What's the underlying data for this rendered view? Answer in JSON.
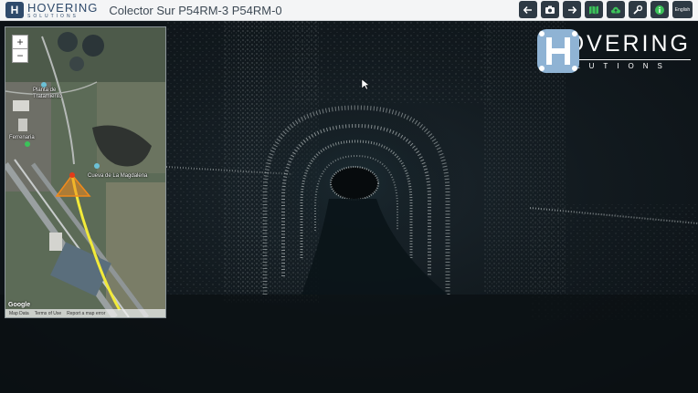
{
  "app": {
    "brand_name": "HOVERING",
    "brand_sub": "SOLUTIONS",
    "title": "Colector Sur P54RM-3 P54RM-0"
  },
  "toolbar": {
    "buttons": [
      {
        "icon": "arrow-left-icon"
      },
      {
        "icon": "camera-icon"
      },
      {
        "icon": "arrow-right-icon"
      },
      {
        "icon": "map-icon"
      },
      {
        "icon": "cloud-upload-icon"
      },
      {
        "icon": "wrench-icon"
      },
      {
        "icon": "info-icon"
      }
    ],
    "language": "English"
  },
  "watermark": {
    "name": "HOVERING",
    "sub": "SOLUTIONS"
  },
  "minimap": {
    "zoom_in": "+",
    "zoom_out": "−",
    "labels": {
      "poi_1": "Planta de",
      "poi_2": "Tratamiento",
      "poi_3": "Cueva de La Magdalena",
      "poi_4": "Ferrenaria"
    },
    "footer": {
      "map_data": "Map Data",
      "terms": "Terms of Use",
      "report": "Report a map error"
    },
    "attribution": "Google"
  },
  "colors": {
    "path": "#f2ea3a",
    "marker": "#f08a1c",
    "toolbar_button": "#2e3a44",
    "brand": "#2f4a6b"
  }
}
